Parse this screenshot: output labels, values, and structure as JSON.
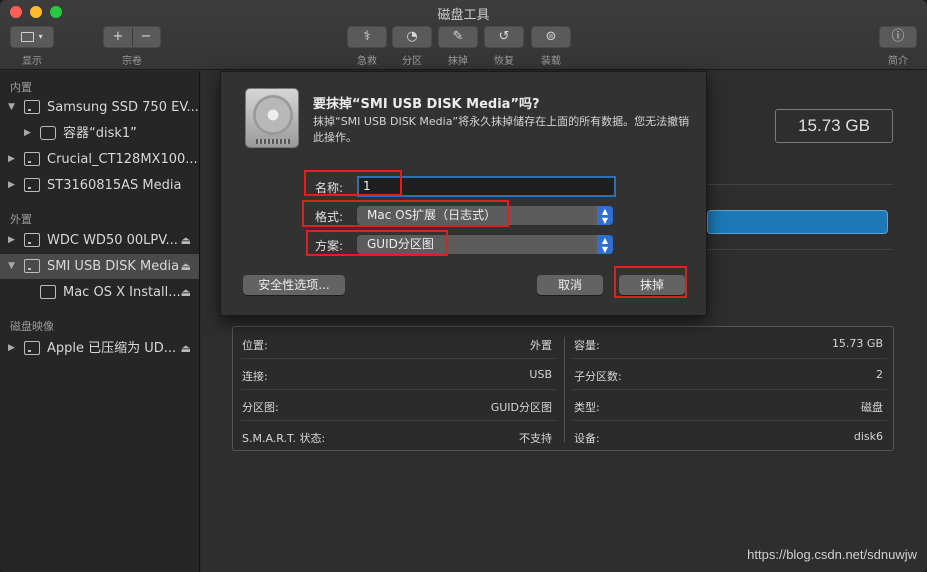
{
  "window": {
    "title": "磁盘工具"
  },
  "toolbar": {
    "view_label": "显示",
    "volume_label": "宗卷",
    "add_glyph": "+",
    "remove_glyph": "−",
    "buttons": [
      {
        "label": "急救",
        "icon": "stethoscope-icon",
        "glyph": "⚕"
      },
      {
        "label": "分区",
        "icon": "pie-icon",
        "glyph": "◔"
      },
      {
        "label": "抹掉",
        "icon": "eraser-icon",
        "glyph": "✎"
      },
      {
        "label": "恢复",
        "icon": "restore-icon",
        "glyph": "↺"
      },
      {
        "label": "装载",
        "icon": "mount-icon",
        "glyph": "⊜"
      }
    ],
    "info_label": "简介",
    "info_glyph": "ⓘ"
  },
  "sidebar": {
    "sections": {
      "internal": "内置",
      "external": "外置",
      "images": "磁盘映像"
    },
    "items": [
      {
        "label": "Samsung SSD 750 EV...",
        "expanded": true
      },
      {
        "label": "容器“disk1”",
        "expanded": false
      },
      {
        "label": "Crucial_CT128MX100...",
        "expanded": false
      },
      {
        "label": "ST3160815AS Media",
        "expanded": false
      },
      {
        "label": "WDC WD50 00LPV...",
        "expanded": false,
        "eject": "⏏"
      },
      {
        "label": "SMI USB DISK Media",
        "expanded": true,
        "eject": "⏏",
        "selected": true
      },
      {
        "label": "Mac OS X Install...",
        "eject": "⏏"
      },
      {
        "label": "Apple 已压缩为 UD...",
        "expanded": false,
        "eject": "⏏"
      }
    ]
  },
  "main": {
    "capacity": "15.73 GB",
    "usage_color": "#1c79b6",
    "info": {
      "left": [
        {
          "label": "位置:",
          "value": "外置"
        },
        {
          "label": "连接:",
          "value": "USB"
        },
        {
          "label": "分区图:",
          "value": "GUID分区图"
        },
        {
          "label": "S.M.A.R.T. 状态:",
          "value": "不支持"
        }
      ],
      "right": [
        {
          "label": "容量:",
          "value": "15.73 GB"
        },
        {
          "label": "子分区数:",
          "value": "2"
        },
        {
          "label": "类型:",
          "value": "磁盘"
        },
        {
          "label": "设备:",
          "value": "disk6"
        }
      ]
    }
  },
  "dialog": {
    "title": "要抹掉“SMI USB DISK Media”吗?",
    "description": "抹掉“SMI USB DISK Media”将永久抹掉储存在上面的所有数据。您无法撤销此操作。",
    "name_label": "名称:",
    "name_value": "1",
    "format_label": "格式:",
    "format_value": "Mac OS扩展（日志式）",
    "scheme_label": "方案:",
    "scheme_value": "GUID分区图",
    "security_button": "安全性选项...",
    "cancel_button": "取消",
    "erase_button": "抹掉",
    "updown_glyph": "▲▼"
  },
  "annotation_color": "#e02020",
  "watermark": "https://blog.csdn.net/sdnuwjw"
}
